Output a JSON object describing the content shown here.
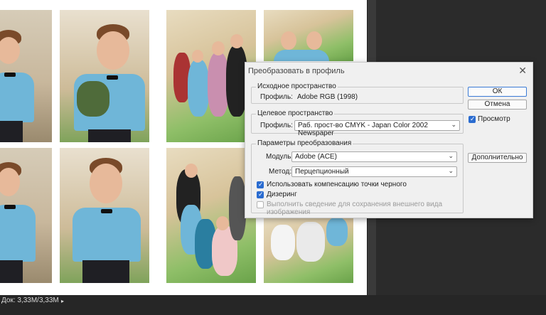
{
  "status": {
    "doc_info": "Док: 3,33M/3,33M",
    "arrow": "▸"
  },
  "dialog": {
    "title": "Преобразовать в профиль",
    "close_glyph": "✕",
    "source": {
      "group_title": "Исходное пространство",
      "profile_label": "Профиль:",
      "profile_value": "Adobe RGB (1998)"
    },
    "destination": {
      "group_title": "Целевое пространство",
      "profile_label": "Профиль:",
      "profile_value": "Раб. прост-во CMYK - Japan Color 2002 Newspaper"
    },
    "options": {
      "group_title": "Параметры преобразования",
      "engine_label": "Модуль:",
      "engine_value": "Adobe (ACE)",
      "intent_label": "Метод:",
      "intent_value": "Перцепционный",
      "black_point_label": "Использовать компенсацию точки черного",
      "dither_label": "Дизеринг",
      "flatten_label": "Выполнить сведение для сохранения внешнего вида изображения"
    },
    "buttons": {
      "ok": "ОК",
      "cancel": "Отмена",
      "preview": "Просмотр",
      "advanced": "Дополнительно"
    }
  },
  "colors": {
    "accent": "#2b6cd0",
    "shirt": "#6fb6d8",
    "workspace": "#2b2b2b"
  }
}
